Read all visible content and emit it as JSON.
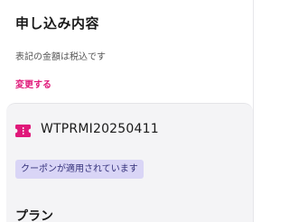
{
  "order": {
    "title": "申し込み内容",
    "tax_note": "表記の金額は税込です",
    "change_label": "変更する"
  },
  "coupon": {
    "icon": "ticket-icon",
    "code": "WTPRMI20250411",
    "applied_label": "クーポンが適用されています"
  },
  "plan": {
    "heading": "プラン"
  },
  "colors": {
    "accent": "#e0197a",
    "badge_bg": "#d9d5f6",
    "badge_text": "#33307a",
    "panel_bg": "#f4f4f6"
  }
}
